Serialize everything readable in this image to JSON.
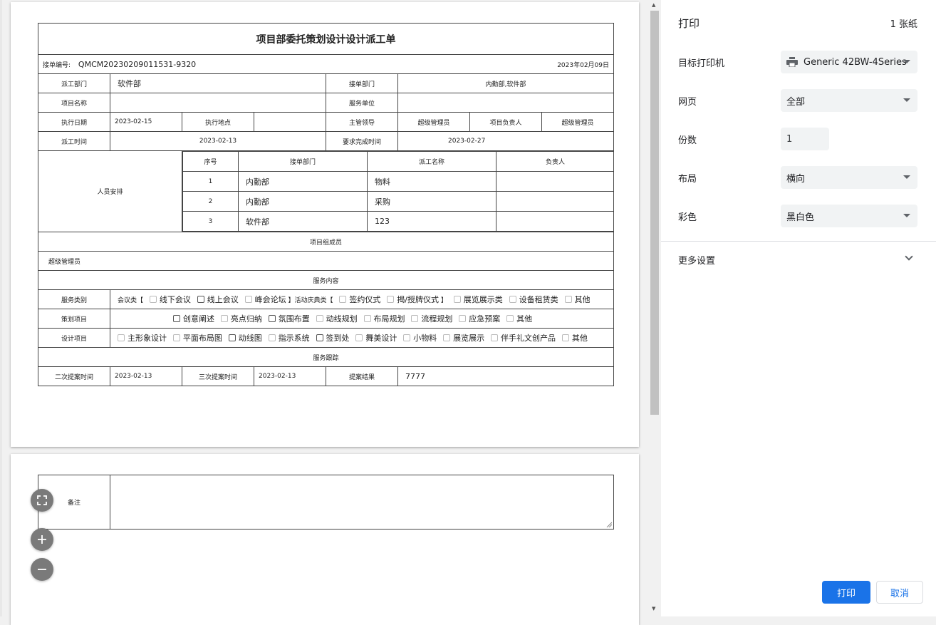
{
  "form": {
    "title": "项目部委托策划设计设计派工单",
    "order_no_label": "接单编号:",
    "order_no": "QMCM20230209011531-9320",
    "date": "2023年02月09日",
    "dispatch_dept_label": "派工部门",
    "dispatch_dept": "软件部",
    "receive_dept_label": "接单部门",
    "receive_dept": "内勤部,软件部",
    "project_name_label": "项目名称",
    "project_name": "",
    "service_unit_label": "服务单位",
    "service_unit": "",
    "exec_date_label": "执行日期",
    "exec_date": "2023-02-15",
    "exec_place_label": "执行地点",
    "exec_place": "",
    "leader_label": "主管领导",
    "leader": "超级管理员",
    "project_owner_label": "项目负责人",
    "project_owner": "超级管理员",
    "dispatch_time_label": "派工时间",
    "dispatch_time": "2023-02-13",
    "due_time_label": "要求完成时间",
    "due_time": "2023-02-27",
    "staff_label": "人员安排",
    "staff_headers": [
      "序号",
      "接单部门",
      "派工名称",
      "负责人"
    ],
    "staff_rows": [
      {
        "no": "1",
        "dept": "内勤部",
        "task": "物料",
        "owner": ""
      },
      {
        "no": "2",
        "dept": "内勤部",
        "task": "采购",
        "owner": ""
      },
      {
        "no": "3",
        "dept": "软件部",
        "task": "123",
        "owner": ""
      }
    ],
    "members_header": "项目组成员",
    "members": "超级管理员",
    "service_content_header": "服务内容",
    "service_type_label": "服务类别",
    "meeting_type": "会议类【",
    "meeting_options": [
      "线下会议",
      "线上会议",
      "峰会论坛"
    ],
    "meeting_close": "】",
    "event_type": "活动庆典类【",
    "event_options": [
      "签约仪式",
      "揭/授牌仪式"
    ],
    "event_close": "】",
    "other_service_options": [
      "展览展示类",
      "设备租赁类",
      "其他"
    ],
    "planning_label": "策划项目",
    "planning_options": [
      "创意阐述",
      "亮点归纳",
      "氛围布置",
      "动线规划",
      "布局规划",
      "流程规划",
      "应急预案",
      "其他"
    ],
    "design_label": "设计项目",
    "design_options": [
      "主形象设计",
      "平面布局图",
      "动线图",
      "指示系统",
      "签到处",
      "舞美设计",
      "小物料",
      "展览展示",
      "伴手礼文创产品",
      "其他"
    ],
    "tracking_header": "服务跟踪",
    "second_time_label": "二次提案时间",
    "second_time": "2023-02-13",
    "third_time_label": "三次提案时间",
    "third_time": "2023-02-13",
    "result_label": "提案结果",
    "result": "7777",
    "remark_label": "备注",
    "remark": ""
  },
  "zoom": {
    "fit_icon": "fit-to-page-icon",
    "zoom_in_icon": "zoom-in-icon",
    "zoom_out_icon": "zoom-out-icon"
  },
  "print_panel": {
    "title": "打印",
    "sheet_count": "1 张纸",
    "printer_label": "目标打印机",
    "printer_value": "Generic 42BW-4Series",
    "pages_label": "网页",
    "pages_value": "全部",
    "copies_label": "份数",
    "copies_value": "1",
    "layout_label": "布局",
    "layout_value": "横向",
    "color_label": "彩色",
    "color_value": "黑白色",
    "more_settings": "更多设置",
    "print_button": "打印",
    "cancel_button": "取消",
    "accent_color": "#1a73e8"
  }
}
